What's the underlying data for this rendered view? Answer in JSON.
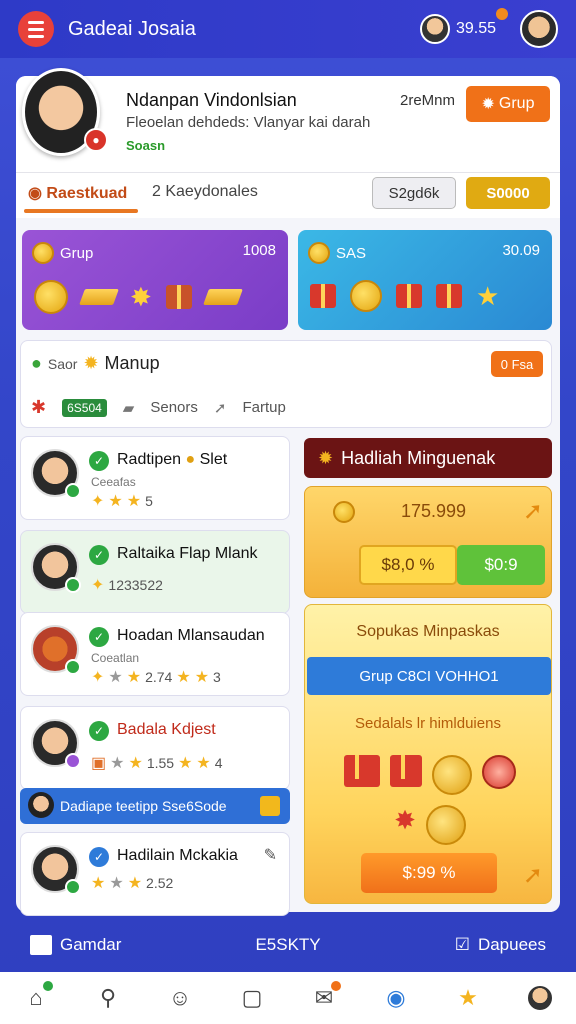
{
  "header": {
    "title": "Gadeai Josaia",
    "coins": "39.55"
  },
  "profile": {
    "name": "Ndanpan Vindonlsian",
    "subtitle": "Fleoelan dehdeds: Vlanyar kai darah",
    "status": "Soasn",
    "time": "2reMnm",
    "grup_button": "Grup"
  },
  "tabs": {
    "active": "Raestkuad",
    "second": "2 Kaeydonales",
    "btn_grey": "S2gd6k",
    "btn_gold": "S0000"
  },
  "cards": {
    "purple": {
      "label": "Grup",
      "value": "1008"
    },
    "blue": {
      "label": "SAS",
      "value": "30.09"
    }
  },
  "mission": {
    "prefix": "Saor",
    "title": "Manup",
    "badge": "0 Fsa",
    "chip": "6S504",
    "item1": "Senors",
    "item2": "Fartup"
  },
  "list": [
    {
      "name": "Radtipen",
      "name_extra": "Slet",
      "sub": "Ceeafas",
      "stars": "5"
    },
    {
      "name": "Raltaika Flap Mlank",
      "name_extra": "",
      "sub": "",
      "stars": "1233522"
    },
    {
      "name": "Hoadan Mlansaudan",
      "name_extra": "",
      "sub": "Coeatlan",
      "stars": "2.74",
      "stars2": "3"
    },
    {
      "name": "Badala Kdjest",
      "name_extra": "",
      "sub": "",
      "stars": "1.55",
      "stars2": "4"
    },
    {
      "name": "Hadilain Mckakia",
      "name_extra": "",
      "sub": "",
      "stars": "2.52"
    }
  ],
  "banner": "Dadiape teetipp Sse6Sode",
  "reward": {
    "title": "Hadliah Minguenak",
    "value": "175.999",
    "btn_yellow": "$8,0 %",
    "btn_green": "$0:9",
    "box2_title": "Sopukas Minpaskas",
    "box2_button": "Grup C8CI VOHHO1",
    "box2_sub": "Sedalals lr himlduiens",
    "price": "$:99 %"
  },
  "bottom_strip": {
    "left": "Gamdar",
    "center": "E5SKTY",
    "right": "Dapuees"
  }
}
